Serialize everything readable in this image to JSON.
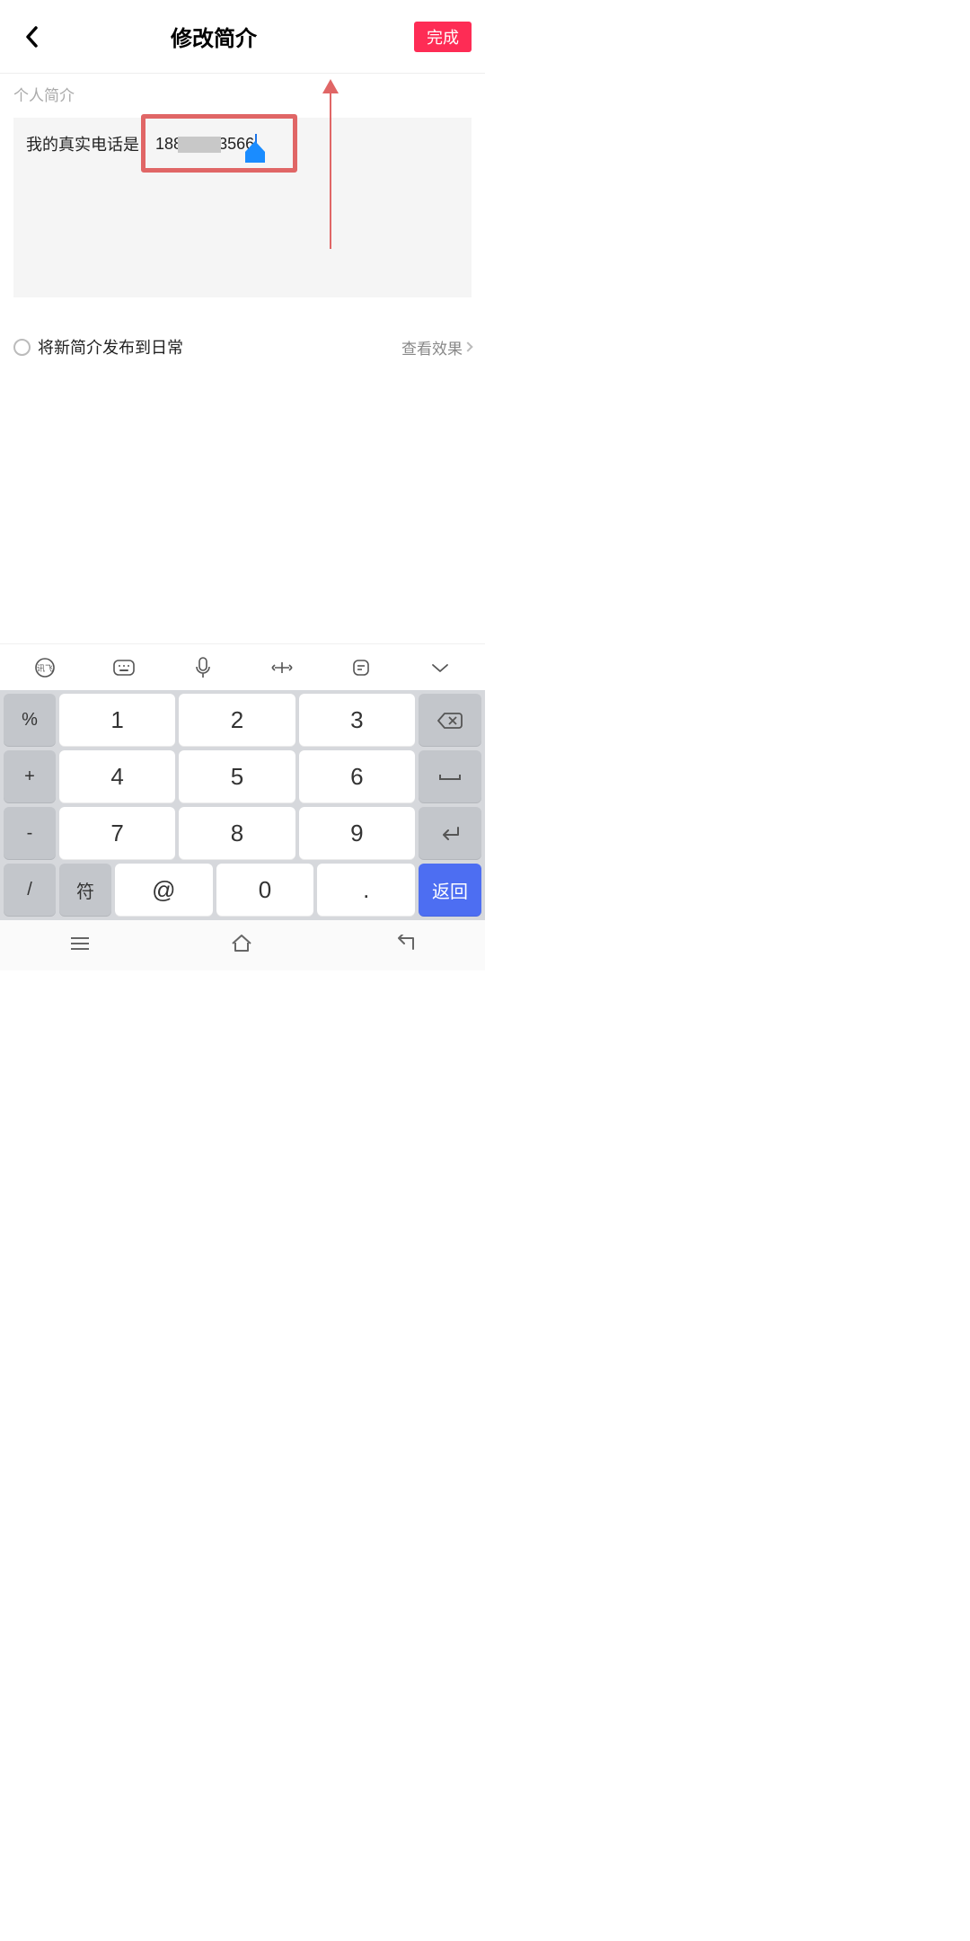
{
  "header": {
    "title": "修改简介",
    "done": "完成"
  },
  "section": {
    "label": "个人简介",
    "text_prefix": "我的真实电话是：",
    "text_value": "18885503566"
  },
  "publish": {
    "label": "将新简介发布到日常",
    "preview": "查看效果"
  },
  "keypad": {
    "side": [
      "%",
      "+",
      "-",
      "/"
    ],
    "rows": [
      [
        "1",
        "2",
        "3"
      ],
      [
        "4",
        "5",
        "6"
      ],
      [
        "7",
        "8",
        "9"
      ]
    ],
    "bottom_left": "符",
    "bottom_mid": [
      "@",
      "0",
      "."
    ],
    "return": "返回"
  }
}
